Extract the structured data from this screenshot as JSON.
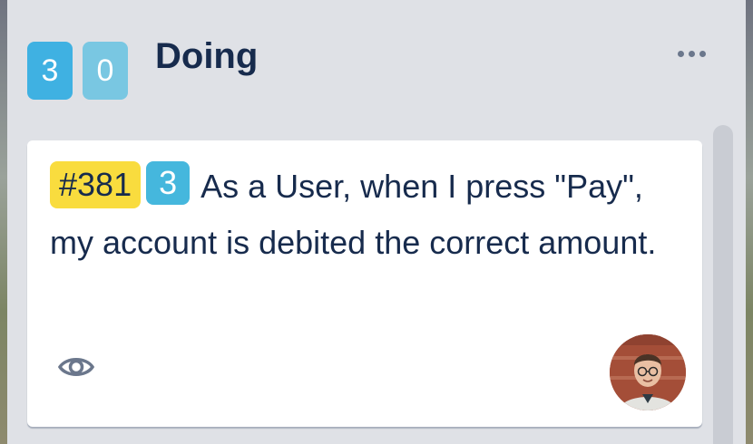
{
  "list": {
    "counters": [
      "3",
      "0"
    ],
    "title": "Doing"
  },
  "card": {
    "issue_id": "#381",
    "points": "3",
    "text_line1": "As a User, when I press",
    "text_rest": "\"Pay\", my account is debited the correct amount.",
    "icons": [
      "eye-icon"
    ],
    "colors": {
      "id_badge": "#f9dc3e",
      "points_badge": "#45b7dd"
    }
  }
}
